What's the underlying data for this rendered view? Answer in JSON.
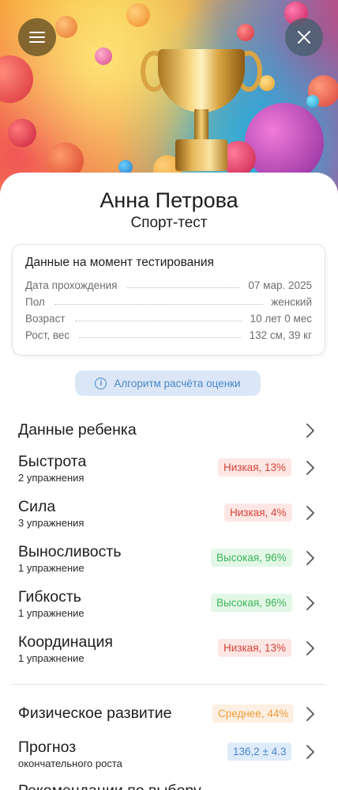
{
  "header": {
    "menu_icon": "menu-icon",
    "close_icon": "close-icon"
  },
  "profile": {
    "name": "Анна Петрова",
    "subtitle": "Спорт-тест"
  },
  "test_info": {
    "title": "Данные на момент тестирования",
    "rows": [
      {
        "label": "Дата прохождения",
        "value": "07 мар. 2025"
      },
      {
        "label": "Пол",
        "value": "женский"
      },
      {
        "label": "Возраст",
        "value": "10 лет 0 мес"
      },
      {
        "label": "Рост, вес",
        "value": "132 см, 39 кг"
      }
    ]
  },
  "algorithm_button": {
    "label": "Алгоритм расчёта оценки",
    "icon": "info-icon"
  },
  "sections": [
    {
      "title": "Данные ребенка",
      "sub": "",
      "badge": ""
    },
    {
      "title": "Быстрота",
      "sub": "2 упражнения",
      "badge": "Низкая, 13%",
      "status": "low"
    },
    {
      "title": "Сила",
      "sub": "3 упражнения",
      "badge": "Низкая, 4%",
      "status": "low"
    },
    {
      "title": "Выносливость",
      "sub": "1 упражнение",
      "badge": "Высокая, 96%",
      "status": "high"
    },
    {
      "title": "Гибкость",
      "sub": "1 упражнение",
      "badge": "Высокая, 96%",
      "status": "high"
    },
    {
      "title": "Координация",
      "sub": "1 упражнение",
      "badge": "Низкая, 13%",
      "status": "low"
    },
    {
      "title": "Физическое развитие",
      "sub": "",
      "badge": "Среднее, 44%",
      "status": "medium"
    },
    {
      "title": "Прогноз",
      "sub": "окончательного роста",
      "badge": "136,2 ± 4.3",
      "status": "info"
    },
    {
      "title": "Рекомендации по выбору",
      "sub": "",
      "badge": ""
    }
  ],
  "colors": {
    "low_bg": "#fde7e4",
    "low_fg": "#d9433a",
    "high_bg": "#e3f7e6",
    "high_fg": "#3cb55a",
    "medium_bg": "#fdf0e2",
    "medium_fg": "#ef9a3c",
    "info_bg": "#deebfa",
    "info_fg": "#4b86c7",
    "accent": "#4b86c7"
  }
}
